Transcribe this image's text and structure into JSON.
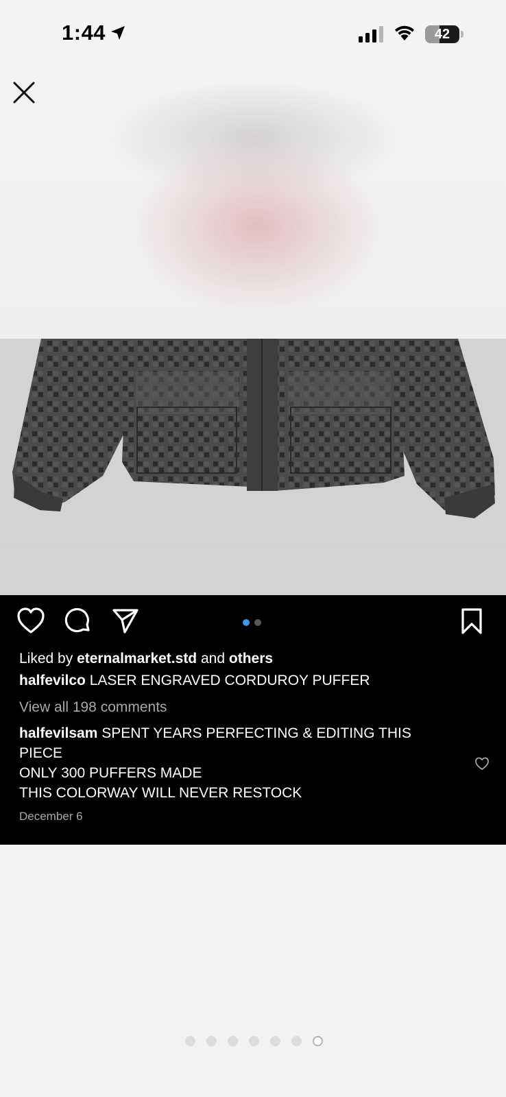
{
  "status_bar": {
    "time": "1:44",
    "battery": "42",
    "battery_level": 0.42
  },
  "post": {
    "liked_by_prefix": "Liked by",
    "liked_by_user": "eternalmarket.std",
    "liked_by_connector": "and",
    "liked_by_others": "others",
    "caption_user": "halfevilco",
    "caption_text": "LASER ENGRAVED CORDUROY PUFFER",
    "view_comments": "View all 198 comments",
    "comment_user": "halfevilsam",
    "comment_lines": [
      "SPENT YEARS PERFECTING & EDITING THIS PIECE",
      "ONLY 300 PUFFERS MADE",
      "THIS COLORWAY WILL NEVER RESTOCK"
    ],
    "date": "December 6",
    "carousel": {
      "count": 2,
      "active": 0
    }
  },
  "story_pages": {
    "count": 7,
    "active": 6
  },
  "colors": {
    "carousel_active": "#3897f0",
    "carousel_inactive": "#5a5a5a",
    "muted_text": "#a8a8a8"
  },
  "icons": [
    "location-arrow-icon",
    "signal-icon",
    "wifi-icon",
    "battery-icon",
    "close-icon",
    "heart-icon",
    "comment-icon",
    "share-icon",
    "bookmark-icon",
    "comment-heart-icon"
  ]
}
